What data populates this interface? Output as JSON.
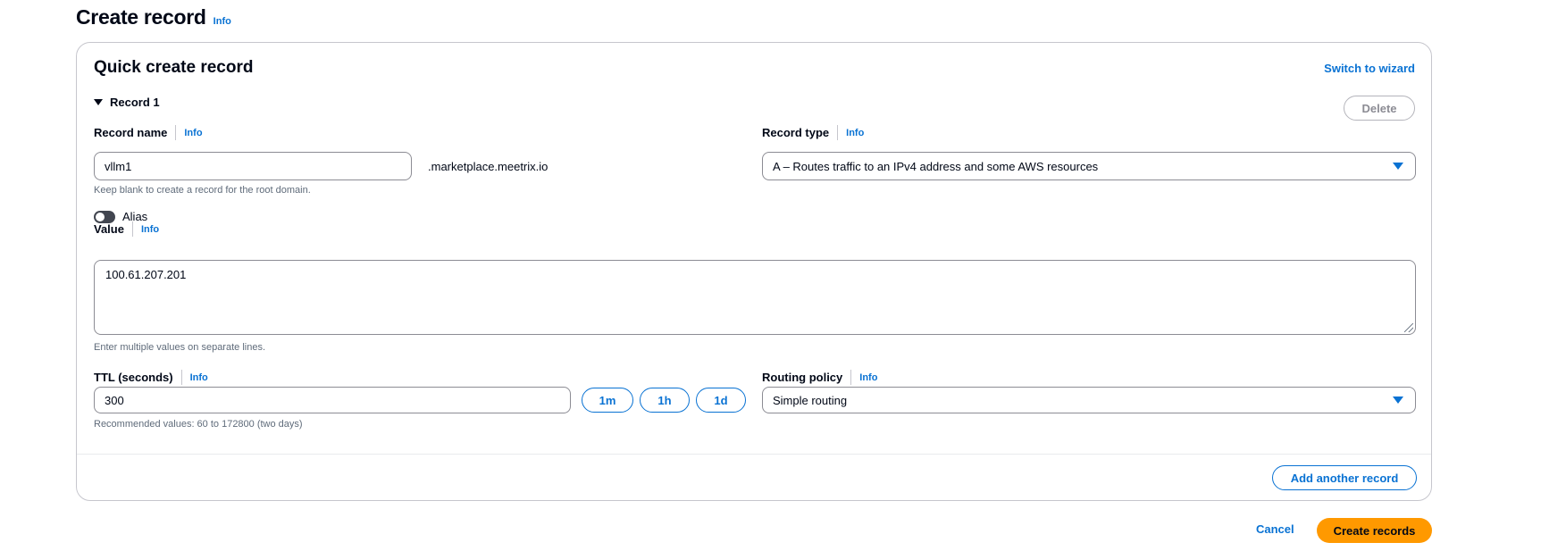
{
  "page": {
    "title": "Create record",
    "info_label": "Info"
  },
  "panel": {
    "title": "Quick create record",
    "switch_label": "Switch to wizard",
    "record_toggle_label": "Record 1",
    "delete_label": "Delete"
  },
  "record_name": {
    "label": "Record name",
    "info": "Info",
    "value": "vllm1",
    "suffix": ".marketplace.meetrix.io",
    "hint": "Keep blank to create a record for the root domain."
  },
  "record_type": {
    "label": "Record type",
    "info": "Info",
    "selected": "A – Routes traffic to an IPv4 address and some AWS resources"
  },
  "alias": {
    "label": "Alias",
    "enabled": false
  },
  "value_field": {
    "label": "Value",
    "info": "Info",
    "value": "100.61.207.201",
    "hint": "Enter multiple values on separate lines."
  },
  "ttl": {
    "label": "TTL (seconds)",
    "info": "Info",
    "value": "300",
    "hint": "Recommended values: 60 to 172800 (two days)",
    "presets": [
      "1m",
      "1h",
      "1d"
    ]
  },
  "routing_policy": {
    "label": "Routing policy",
    "info": "Info",
    "selected": "Simple routing"
  },
  "footer": {
    "add_record_label": "Add another record",
    "cancel_label": "Cancel",
    "create_label": "Create records"
  },
  "colors": {
    "accent": "#0972d3",
    "primary_button": "#ff9900",
    "border": "#8c8c94"
  }
}
